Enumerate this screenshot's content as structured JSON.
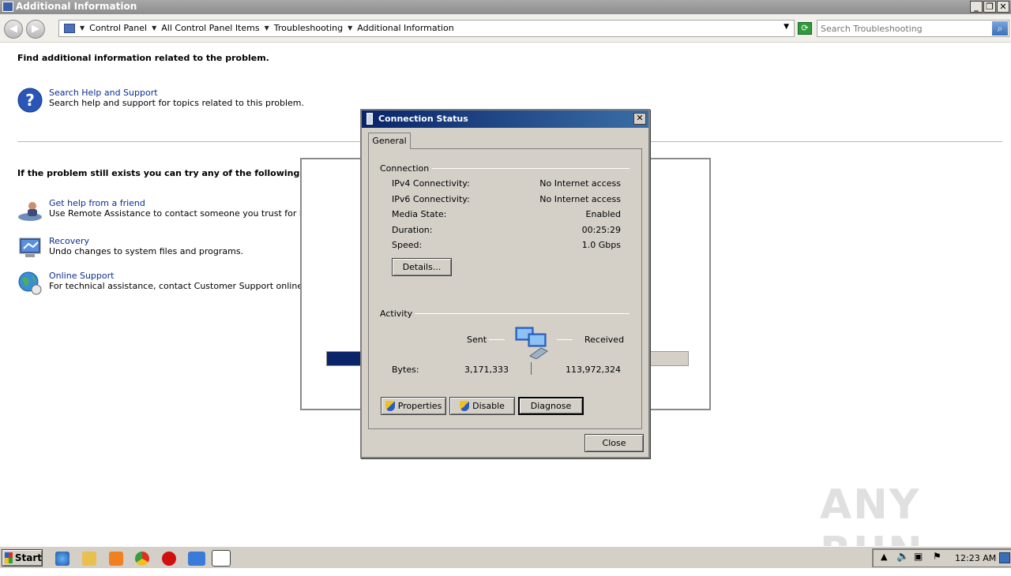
{
  "window": {
    "title": "Additional Information",
    "minimize": "_",
    "restore": "❐",
    "close": "✕"
  },
  "address": {
    "crumbs": [
      "Control Panel",
      "All Control Panel Items",
      "Troubleshooting",
      "Additional Information"
    ],
    "search_placeholder": "Search Troubleshooting"
  },
  "main": {
    "heading1": "Find additional information related to the problem.",
    "help_link": "Search Help and Support",
    "help_desc": "Search help and support for topics related to this problem.",
    "heading2": "If the problem still exists you can try any of the following to res",
    "tasks": [
      {
        "link": "Get help from a friend",
        "desc": "Use Remote Assistance to contact someone you trust for help"
      },
      {
        "link": "Recovery",
        "desc": "Undo changes to system files and programs."
      },
      {
        "link": "Online Support",
        "desc": "For technical assistance, contact Customer Support online."
      }
    ]
  },
  "background_dialog": {
    "progress_fraction": 0.1
  },
  "dialog": {
    "title": "Connection Status",
    "tab": "General",
    "connection_group": "Connection",
    "rows": [
      {
        "label": "IPv4 Connectivity:",
        "value": "No Internet access"
      },
      {
        "label": "IPv6 Connectivity:",
        "value": "No Internet access"
      },
      {
        "label": "Media State:",
        "value": "Enabled"
      },
      {
        "label": "Duration:",
        "value": "00:25:29"
      },
      {
        "label": "Speed:",
        "value": "1.0 Gbps"
      }
    ],
    "details_button": "Details...",
    "activity_group": "Activity",
    "sent_label": "Sent",
    "received_label": "Received",
    "bytes_label": "Bytes:",
    "bytes_sent": "3,171,333",
    "bytes_received": "113,972,324",
    "properties_button": "Properties",
    "disable_button": "Disable",
    "diagnose_button": "Diagnose",
    "close_button": "Close"
  },
  "taskbar": {
    "start": "Start",
    "clock": "12:23 AM"
  },
  "watermark": "ANY RUN"
}
